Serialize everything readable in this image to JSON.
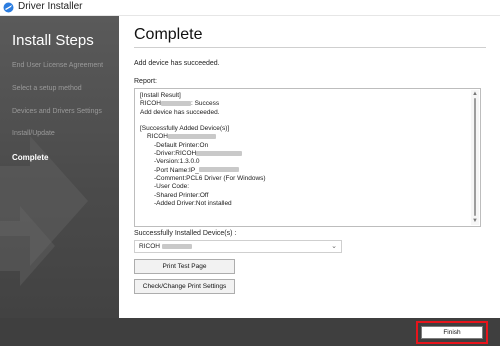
{
  "window": {
    "title": "Driver Installer",
    "icon": "driver-installer-icon"
  },
  "sidebar": {
    "title": "Install Steps",
    "steps": [
      {
        "label": "End User License Agreement",
        "active": false
      },
      {
        "label": "Select a setup method",
        "active": false
      },
      {
        "label": "Devices and Drivers Settings",
        "active": false
      },
      {
        "label": "Install/Update",
        "active": false
      },
      {
        "label": "Complete",
        "active": true
      }
    ]
  },
  "main": {
    "title": "Complete",
    "message": "Add device has succeeded.",
    "report_label": "Report:",
    "report_lines": {
      "l1": "[Install Result]",
      "l2_prefix": "RICOH",
      "l2_suffix": ": Success",
      "l3": "Add device has succeeded.",
      "l4": "",
      "l5": "[Successfully Added Device(s)]",
      "l6_prefix": "RICOH",
      "l7": "-Default Printer:On",
      "l8_prefix": "-Driver:RICOH",
      "l9": "-Version:1.3.0.0",
      "l10_prefix": "-Port Name:IP_",
      "l11": "-Comment:PCL6 Driver (For Windows)",
      "l12": "-User Code:",
      "l13": "-Shared Printer:Off",
      "l14": "-Added Driver:Not installed"
    },
    "installed_label": "Successfully Installed Device(s) :",
    "installed_value": "RICOH",
    "buttons": {
      "print_test_page": "Print Test Page",
      "check_change_settings": "Check/Change Print Settings"
    }
  },
  "footer": {
    "finish": "Finish"
  },
  "colors": {
    "highlight": "#e8141b",
    "sidebar": "#4b4b4b",
    "footer": "#3f3f3f"
  }
}
